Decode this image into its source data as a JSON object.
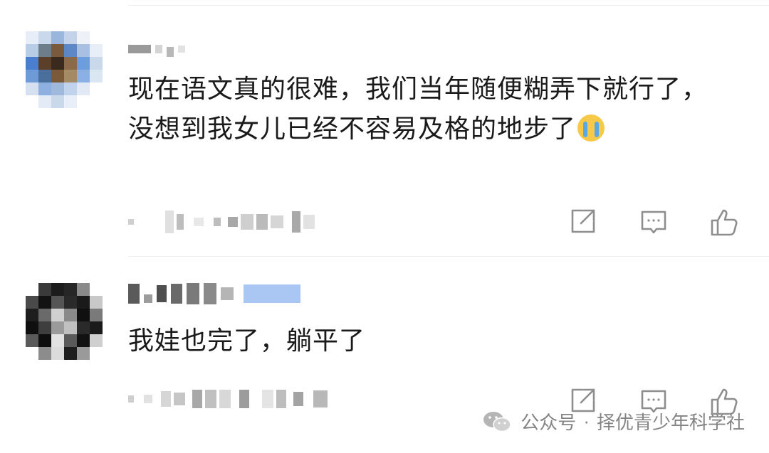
{
  "comments": [
    {
      "text": "现在语文真的很难，我们当年随便糊弄下就行了，没想到我女儿已经不容易及格的地步了",
      "emoji": "loudly-crying-face"
    },
    {
      "text": "我娃也完了，躺平了"
    }
  ],
  "actions": {
    "share_icon": "share-icon",
    "reply_icon": "comment-icon",
    "like_icon": "thumbs-up-icon"
  },
  "watermark": {
    "prefix": "公众号",
    "separator": "·",
    "account": "择优青少年科学社"
  },
  "colors": {
    "icon": "#8e8e8e",
    "text": "#1a1a1a",
    "divider": "#ececec",
    "highlight_blue": "#a9c7f2"
  }
}
